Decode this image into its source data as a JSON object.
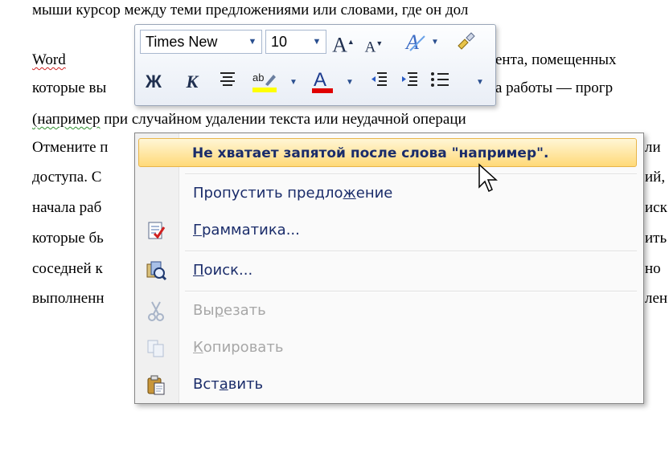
{
  "document": {
    "lines": [
      {
        "text": "мыши курсор между теми предложениями или словами, где он дол"
      },
      {
        "pre": "",
        "squig": "Word",
        "post": " запоминает последние изменения документа, помещенных"
      },
      {
        "text": "которые вы сделали с момента начала работы — програ"
      },
      {
        "pre": "",
        "squig": "(например",
        "post": " при случайном удалении текста  или неудачной операци"
      },
      {
        "text": "Отмените последние изменения документа или"
      },
      {
        "text": "доступа. Сохраните или отмените изменений,"
      },
      {
        "text": "начала работы, выбрав для этого последних иск"
      },
      {
        "text": "которые были сделаны — выберите и выполнить"
      },
      {
        "text": "соседней кнопки, а затем, последовательно но"
      },
      {
        "text": "выполненных действий, если они были выполнены"
      }
    ],
    "right_fragments": [
      {
        "text": "ента, помещенных",
        "line": 1
      },
      {
        "text": "а работы — прогр",
        "line": 2
      },
      {
        "text": "ли",
        "line": 4
      },
      {
        "text": "ий,",
        "line": 5
      },
      {
        "text": "иск",
        "line": 6
      },
      {
        "text": "ить",
        "line": 7
      },
      {
        "text": "но",
        "line": 8
      },
      {
        "text": "лен",
        "line": 9
      }
    ],
    "left_fragments": [
      {
        "text": "Отмените п",
        "line": 4
      },
      {
        "text": "доступа. С",
        "line": 5
      },
      {
        "text": "начала раб",
        "line": 6
      },
      {
        "text": "которые бь",
        "line": 7
      },
      {
        "text": "соседней к",
        "line": 8
      },
      {
        "text": "выполненн",
        "line": 9
      }
    ],
    "top_partial": "мыши курсор между теми предложениями или словами, где он дол",
    "word_line_right": "которые вы"
  },
  "mini_toolbar": {
    "font_name": "Times New",
    "font_size": "10",
    "bold_label": "Ж",
    "italic_label": "К",
    "font_color_label": "A",
    "highlight_label": "ab",
    "grow_label": "A",
    "shrink_label": "A",
    "icons": [
      "grow-font-icon",
      "shrink-font-icon",
      "styles-icon",
      "format-painter-icon",
      "bold-icon",
      "italic-icon",
      "center-icon",
      "highlight-icon",
      "font-color-icon",
      "decrease-indent-icon",
      "increase-indent-icon",
      "bullets-icon"
    ],
    "highlight_color": "#ffff00",
    "font_color": "#e00000"
  },
  "context_menu": {
    "suggestion": "Не хватает запятой после слова \"например\".",
    "items": [
      {
        "label_pre": "Пропустить предло",
        "label_ul": "ж",
        "label_post": "ение",
        "enabled": true
      },
      {
        "label_pre": "",
        "label_ul": "Г",
        "label_post": "рамматика...",
        "enabled": true,
        "icon": "grammar-icon"
      },
      {
        "label_pre": "",
        "label_ul": "П",
        "label_post": "оиск...",
        "enabled": true,
        "icon": "research-icon"
      },
      {
        "label_pre": "Вы",
        "label_ul": "р",
        "label_post": "езать",
        "enabled": false,
        "icon": "cut-icon"
      },
      {
        "label_pre": "",
        "label_ul": "К",
        "label_post": "опировать",
        "enabled": false,
        "icon": "copy-icon"
      },
      {
        "label_pre": "Вст",
        "label_ul": "а",
        "label_post": "вить",
        "enabled": true,
        "icon": "paste-icon"
      }
    ]
  }
}
